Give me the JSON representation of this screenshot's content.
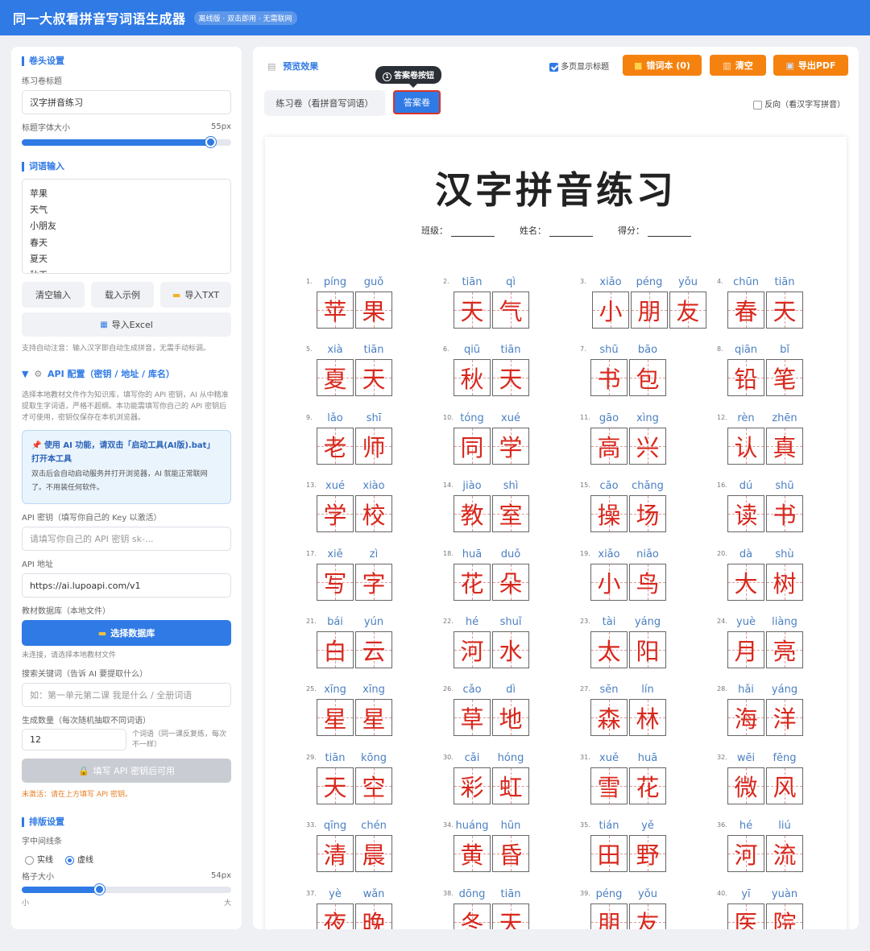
{
  "app": {
    "title": "同一大叔看拼音写词语生成器",
    "badge": "离线版 · 双击即用 · 无需联网"
  },
  "sidebar": {
    "header_section": {
      "title": "卷头设置",
      "title_label": "练习卷标题",
      "title_value": "汉字拼音练习",
      "font_size_label": "标题字体大小",
      "font_size_value": "55px",
      "font_size_fraction": 0.9
    },
    "words_section": {
      "title": "词语输入",
      "words": [
        "苹果",
        "天气",
        "小朋友",
        "春天",
        "夏天",
        "秋天"
      ],
      "clear_button": "清空输入",
      "example_button": "载入示例",
      "import_txt_button": "导入TXT",
      "import_excel_button": "导入Excel",
      "auto_note": "支持自动注音：输入汉字即自动生成拼音，无需手动标调。"
    },
    "api_section": {
      "title": "API 配置（密钥 / 地址 / 库名）",
      "desc": "选择本地教材文件作为知识库，填写你的 API 密钥，AI 从中精准提取生字词语，严格不超纲。本功能需填写你自己的 API 密钥后才可使用，密钥仅保存在本机浏览器。",
      "tip_title": "使用 AI 功能，请双击「启动工具(AI版).bat」打开本工具",
      "tip_desc": "双击后会自动启动服务并打开浏览器，AI 就能正常联网了。不用装任何软件。",
      "key_label": "API 密钥（填写你自己的 Key 以激活）",
      "key_placeholder": "请填写你自己的 API 密钥 sk-...",
      "url_label": "API 地址",
      "url_value": "https://ai.lupoapi.com/v1",
      "db_label": "教材数据库（本地文件）",
      "db_button": "选择数据库",
      "db_status": "未连接，请选择本地教材文件",
      "kw_label": "搜索关键词（告诉 AI 要提取什么）",
      "kw_placeholder": "如：第一单元第二课 我是什么 / 全册词语",
      "count_label": "生成数量（每次随机抽取不同词语）",
      "count_value": "12",
      "count_note": "个词语（同一课反复练，每次不一样）",
      "generate_button": "填写 API 密钥后可用",
      "warning": "未激活：请在上方填写 API 密钥。"
    },
    "layout_section": {
      "title": "排版设置",
      "line_label": "字中间线条",
      "line_options": [
        "实线",
        "虚线"
      ],
      "line_selected": "虚线",
      "cell_size_label": "格子大小",
      "cell_size_value": "54px",
      "cell_size_fraction": 0.37,
      "slider_min": "小",
      "slider_max": "大"
    }
  },
  "main": {
    "preview_title": "预览效果",
    "multi_page_title_label": "多页显示标题",
    "multi_page_title_checked": true,
    "error_book_button": "错词本 (0)",
    "clear_button": "清空",
    "export_button": "导出PDF",
    "tooltip": "答案卷按钮",
    "tooltip_num": "1",
    "tab_sheet": "练习卷（看拼音写词语）",
    "tab_answer": "答案卷",
    "reverse_label": "反向（看汉字写拼音）",
    "reverse_checked": false,
    "paper": {
      "title": "汉字拼音练习",
      "class_label": "班级：",
      "name_label": "姓名：",
      "score_label": "得分：",
      "items": [
        {
          "n": "1.",
          "chars": [
            [
              "píng",
              "苹"
            ],
            [
              "guǒ",
              "果"
            ]
          ]
        },
        {
          "n": "2.",
          "chars": [
            [
              "tiān",
              "天"
            ],
            [
              "qì",
              "气"
            ]
          ]
        },
        {
          "n": "3.",
          "chars": [
            [
              "xiǎo",
              "小"
            ],
            [
              "péng",
              "朋"
            ],
            [
              "yǒu",
              "友"
            ]
          ]
        },
        {
          "n": "4.",
          "chars": [
            [
              "chūn",
              "春"
            ],
            [
              "tiān",
              "天"
            ]
          ]
        },
        {
          "n": "5.",
          "chars": [
            [
              "xià",
              "夏"
            ],
            [
              "tiān",
              "天"
            ]
          ]
        },
        {
          "n": "6.",
          "chars": [
            [
              "qiū",
              "秋"
            ],
            [
              "tiān",
              "天"
            ]
          ]
        },
        {
          "n": "7.",
          "chars": [
            [
              "shū",
              "书"
            ],
            [
              "bāo",
              "包"
            ]
          ]
        },
        {
          "n": "8.",
          "chars": [
            [
              "qiān",
              "铅"
            ],
            [
              "bǐ",
              "笔"
            ]
          ]
        },
        {
          "n": "9.",
          "chars": [
            [
              "lǎo",
              "老"
            ],
            [
              "shī",
              "师"
            ]
          ]
        },
        {
          "n": "10.",
          "chars": [
            [
              "tóng",
              "同"
            ],
            [
              "xué",
              "学"
            ]
          ]
        },
        {
          "n": "11.",
          "chars": [
            [
              "gāo",
              "高"
            ],
            [
              "xìng",
              "兴"
            ]
          ]
        },
        {
          "n": "12.",
          "chars": [
            [
              "rèn",
              "认"
            ],
            [
              "zhēn",
              "真"
            ]
          ]
        },
        {
          "n": "13.",
          "chars": [
            [
              "xué",
              "学"
            ],
            [
              "xiào",
              "校"
            ]
          ]
        },
        {
          "n": "14.",
          "chars": [
            [
              "jiào",
              "教"
            ],
            [
              "shì",
              "室"
            ]
          ]
        },
        {
          "n": "15.",
          "chars": [
            [
              "cāo",
              "操"
            ],
            [
              "chǎng",
              "场"
            ]
          ]
        },
        {
          "n": "16.",
          "chars": [
            [
              "dú",
              "读"
            ],
            [
              "shū",
              "书"
            ]
          ]
        },
        {
          "n": "17.",
          "chars": [
            [
              "xiě",
              "写"
            ],
            [
              "zì",
              "字"
            ]
          ]
        },
        {
          "n": "18.",
          "chars": [
            [
              "huā",
              "花"
            ],
            [
              "duǒ",
              "朵"
            ]
          ]
        },
        {
          "n": "19.",
          "chars": [
            [
              "xiǎo",
              "小"
            ],
            [
              "niǎo",
              "鸟"
            ]
          ]
        },
        {
          "n": "20.",
          "chars": [
            [
              "dà",
              "大"
            ],
            [
              "shù",
              "树"
            ]
          ]
        },
        {
          "n": "21.",
          "chars": [
            [
              "bái",
              "白"
            ],
            [
              "yún",
              "云"
            ]
          ]
        },
        {
          "n": "22.",
          "chars": [
            [
              "hé",
              "河"
            ],
            [
              "shuǐ",
              "水"
            ]
          ]
        },
        {
          "n": "23.",
          "chars": [
            [
              "tài",
              "太"
            ],
            [
              "yáng",
              "阳"
            ]
          ]
        },
        {
          "n": "24.",
          "chars": [
            [
              "yuè",
              "月"
            ],
            [
              "liàng",
              "亮"
            ]
          ]
        },
        {
          "n": "25.",
          "chars": [
            [
              "xīng",
              "星"
            ],
            [
              "xīng",
              "星"
            ]
          ]
        },
        {
          "n": "26.",
          "chars": [
            [
              "cǎo",
              "草"
            ],
            [
              "dì",
              "地"
            ]
          ]
        },
        {
          "n": "27.",
          "chars": [
            [
              "sēn",
              "森"
            ],
            [
              "lín",
              "林"
            ]
          ]
        },
        {
          "n": "28.",
          "chars": [
            [
              "hǎi",
              "海"
            ],
            [
              "yáng",
              "洋"
            ]
          ]
        },
        {
          "n": "29.",
          "chars": [
            [
              "tiān",
              "天"
            ],
            [
              "kōng",
              "空"
            ]
          ]
        },
        {
          "n": "30.",
          "chars": [
            [
              "cǎi",
              "彩"
            ],
            [
              "hóng",
              "虹"
            ]
          ]
        },
        {
          "n": "31.",
          "chars": [
            [
              "xuě",
              "雪"
            ],
            [
              "huā",
              "花"
            ]
          ]
        },
        {
          "n": "32.",
          "chars": [
            [
              "wēi",
              "微"
            ],
            [
              "fēng",
              "风"
            ]
          ]
        },
        {
          "n": "33.",
          "chars": [
            [
              "qīng",
              "清"
            ],
            [
              "chén",
              "晨"
            ]
          ]
        },
        {
          "n": "34.",
          "chars": [
            [
              "huáng",
              "黄"
            ],
            [
              "hūn",
              "昏"
            ]
          ]
        },
        {
          "n": "35.",
          "chars": [
            [
              "tián",
              "田"
            ],
            [
              "yě",
              "野"
            ]
          ]
        },
        {
          "n": "36.",
          "chars": [
            [
              "hé",
              "河"
            ],
            [
              "liú",
              "流"
            ]
          ]
        },
        {
          "n": "37.",
          "chars": [
            [
              "yè",
              "夜"
            ],
            [
              "wǎn",
              "晚"
            ]
          ]
        },
        {
          "n": "38.",
          "chars": [
            [
              "dōng",
              "冬"
            ],
            [
              "tiān",
              "天"
            ]
          ]
        },
        {
          "n": "39.",
          "chars": [
            [
              "péng",
              "朋"
            ],
            [
              "yǒu",
              "友"
            ]
          ]
        },
        {
          "n": "40.",
          "chars": [
            [
              "yī",
              "医"
            ],
            [
              "yuàn",
              "院"
            ]
          ]
        }
      ]
    }
  },
  "colors": {
    "brand": "#2f7ae5",
    "orange": "#f5820f",
    "char_red": "#d8281d",
    "pinyin_blue": "#4a7fc1"
  }
}
